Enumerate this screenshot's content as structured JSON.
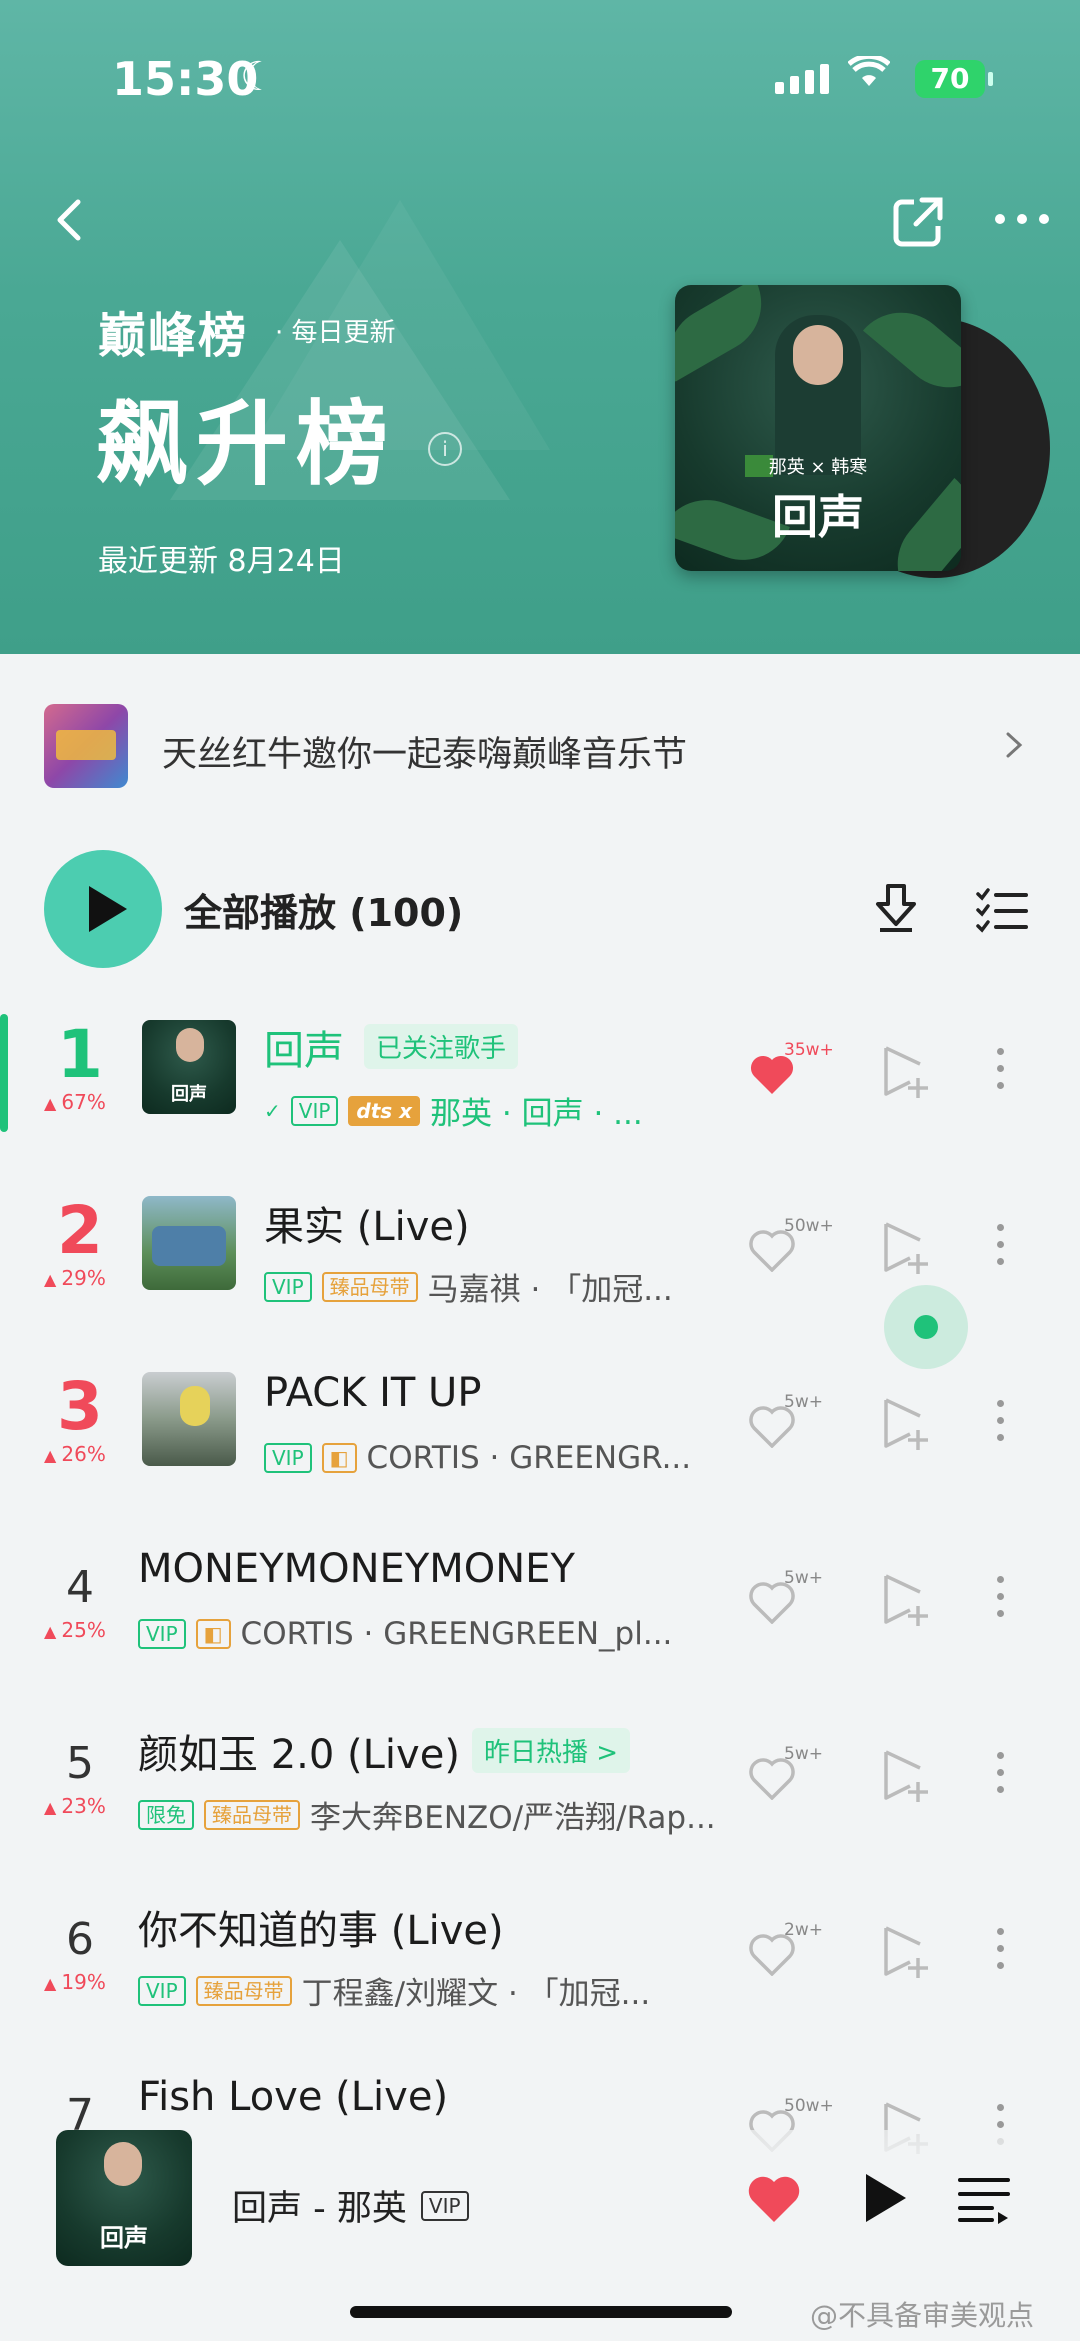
{
  "status_bar": {
    "time": "15:30",
    "battery": "70"
  },
  "header": {
    "brand": "巅峰榜",
    "daily": "· 每日更新",
    "title": "飙升榜",
    "updated": "最近更新 8月24日",
    "cover_title": "回声",
    "cover_line": "那英 × 韩寒"
  },
  "promo": {
    "text": "天丝红牛邀你一起泰嗨巅峰音乐节"
  },
  "playall": {
    "label": "全部播放 (100)"
  },
  "songs": [
    {
      "rank": "1",
      "trend": "67%",
      "title": "回声",
      "pill": "已关注歌手",
      "tags": [
        "VIP",
        "dts x"
      ],
      "artist": "那英 · 回声 · ...",
      "likes": "35w+"
    },
    {
      "rank": "2",
      "trend": "29%",
      "title": "果实 (Live)",
      "tags": [
        "VIP",
        "臻品母带"
      ],
      "artist": "马嘉祺 · 「加冠...",
      "likes": "50w+"
    },
    {
      "rank": "3",
      "trend": "26%",
      "title": "PACK IT UP",
      "tags": [
        "VIP",
        "◧"
      ],
      "artist": "CORTIS · GREENGR...",
      "likes": "5w+"
    },
    {
      "rank": "4",
      "trend": "25%",
      "title": "MONEYMONEYMONEY",
      "tags": [
        "VIP",
        "◧"
      ],
      "artist": "CORTIS · GREENGREEN_pl...",
      "likes": "5w+"
    },
    {
      "rank": "5",
      "trend": "23%",
      "title": "颜如玉 2.0 (Live)",
      "pill": "昨日热播 >",
      "tags": [
        "限免",
        "臻品母带"
      ],
      "artist": "李大奔BENZO/严浩翔/Rap...",
      "likes": "5w+"
    },
    {
      "rank": "6",
      "trend": "19%",
      "title": "你不知道的事 (Live)",
      "tags": [
        "VIP",
        "臻品母带"
      ],
      "artist": "丁程鑫/刘耀文 · 「加冠...",
      "likes": "2w+"
    },
    {
      "rank": "7",
      "trend": "",
      "title": "Fish Love (Live)",
      "tags": [],
      "artist": "",
      "likes": "50w+"
    }
  ],
  "player": {
    "song": "回声 - 那英",
    "tag": "VIP",
    "cover_title": "回声"
  },
  "watermark": "@不具备审美观点",
  "colors": {
    "accent": "#1fc27a",
    "header": "#4aa894",
    "rank_hot": "#f04a5a",
    "heart": "#f04a5a"
  }
}
